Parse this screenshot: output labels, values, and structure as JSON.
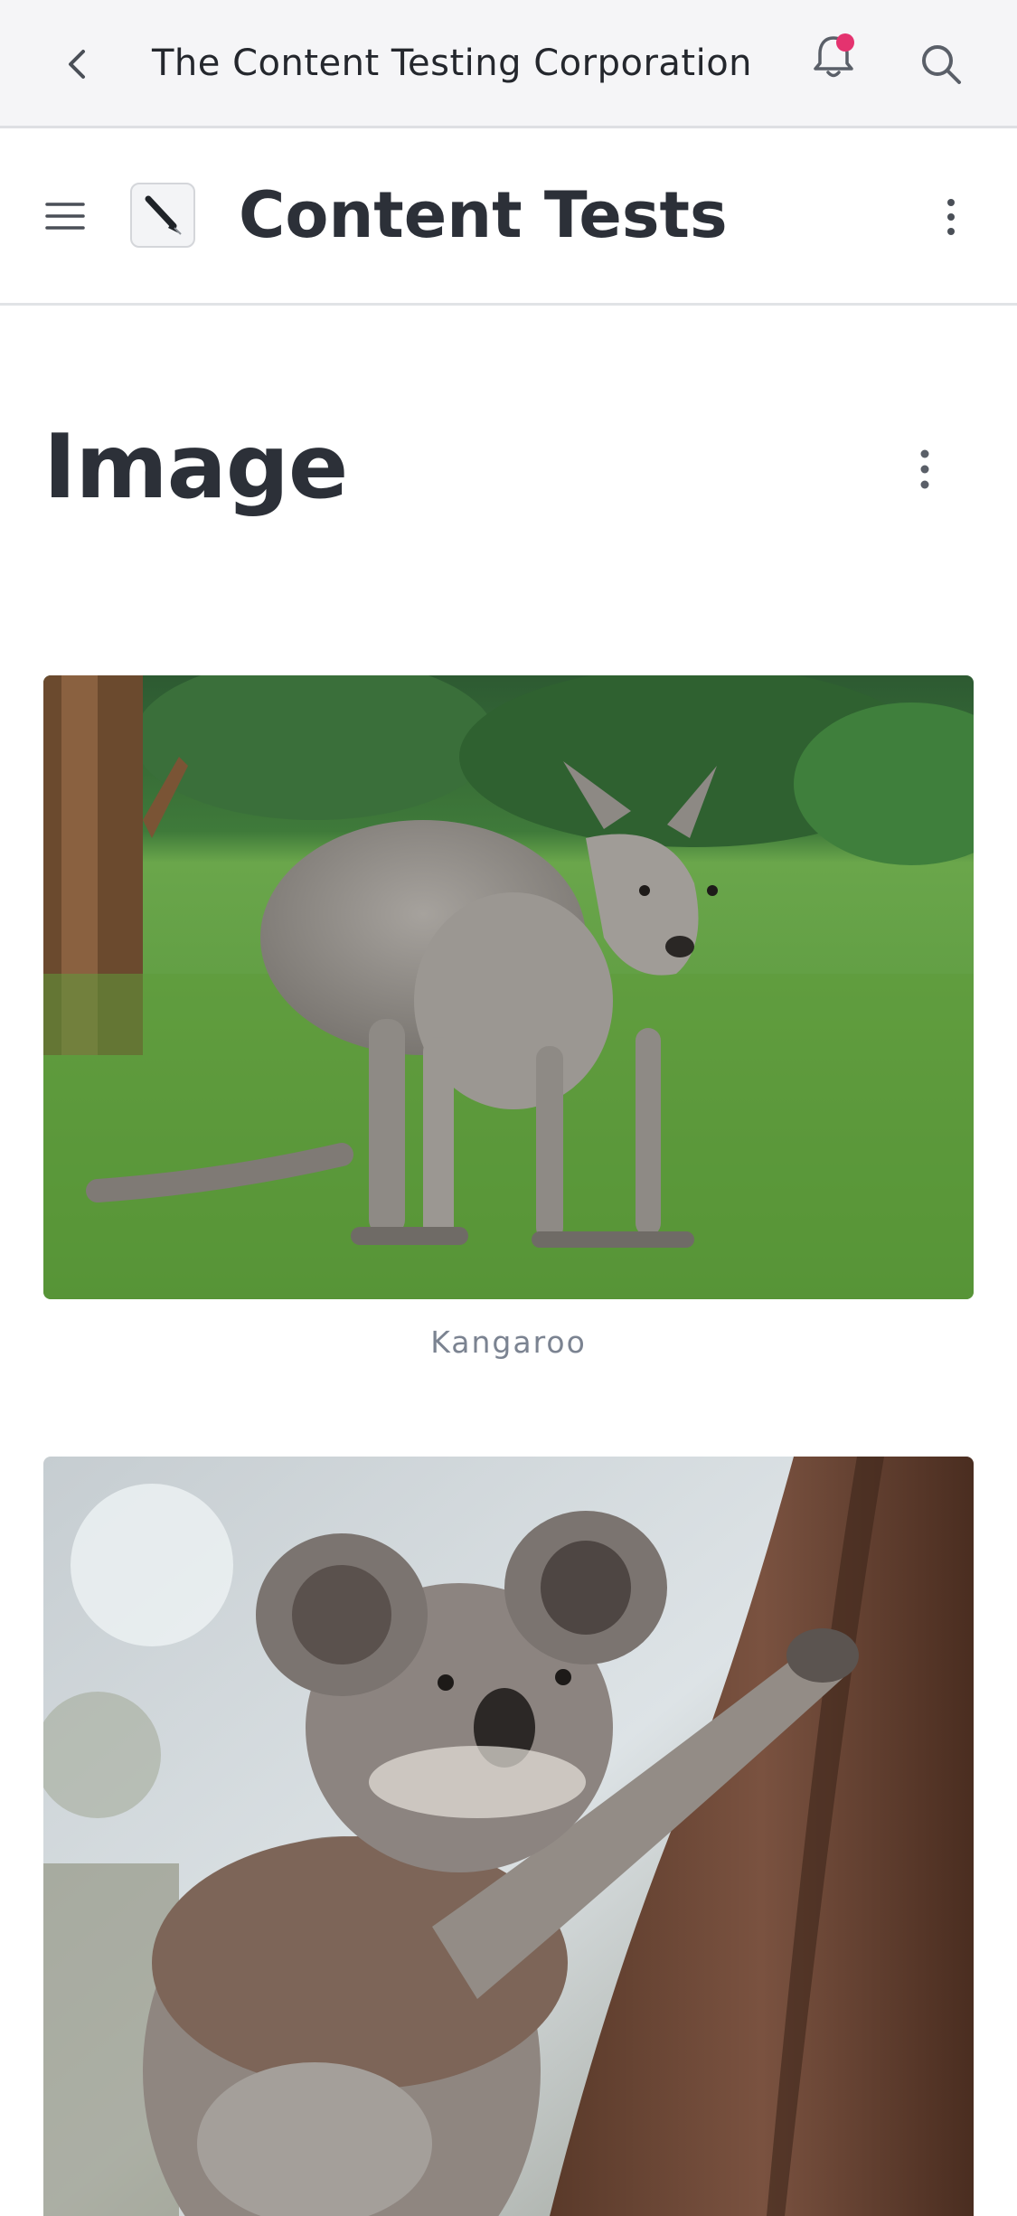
{
  "topbar": {
    "back_icon": "chevron-left-icon",
    "organization": "The Content Testing Corporation",
    "notifications_icon": "bell-icon",
    "notification_dot_color": "#e4336f",
    "search_icon": "search-icon"
  },
  "appbar": {
    "menu_icon": "hamburger-menu-icon",
    "space_icon": "pen-icon",
    "space_title": "Content Tests",
    "more_icon": "kebab-menu-icon"
  },
  "page": {
    "title": "Image",
    "more_icon": "kebab-menu-icon"
  },
  "images": [
    {
      "caption": "Kangaroo"
    },
    {
      "caption": ""
    }
  ]
}
